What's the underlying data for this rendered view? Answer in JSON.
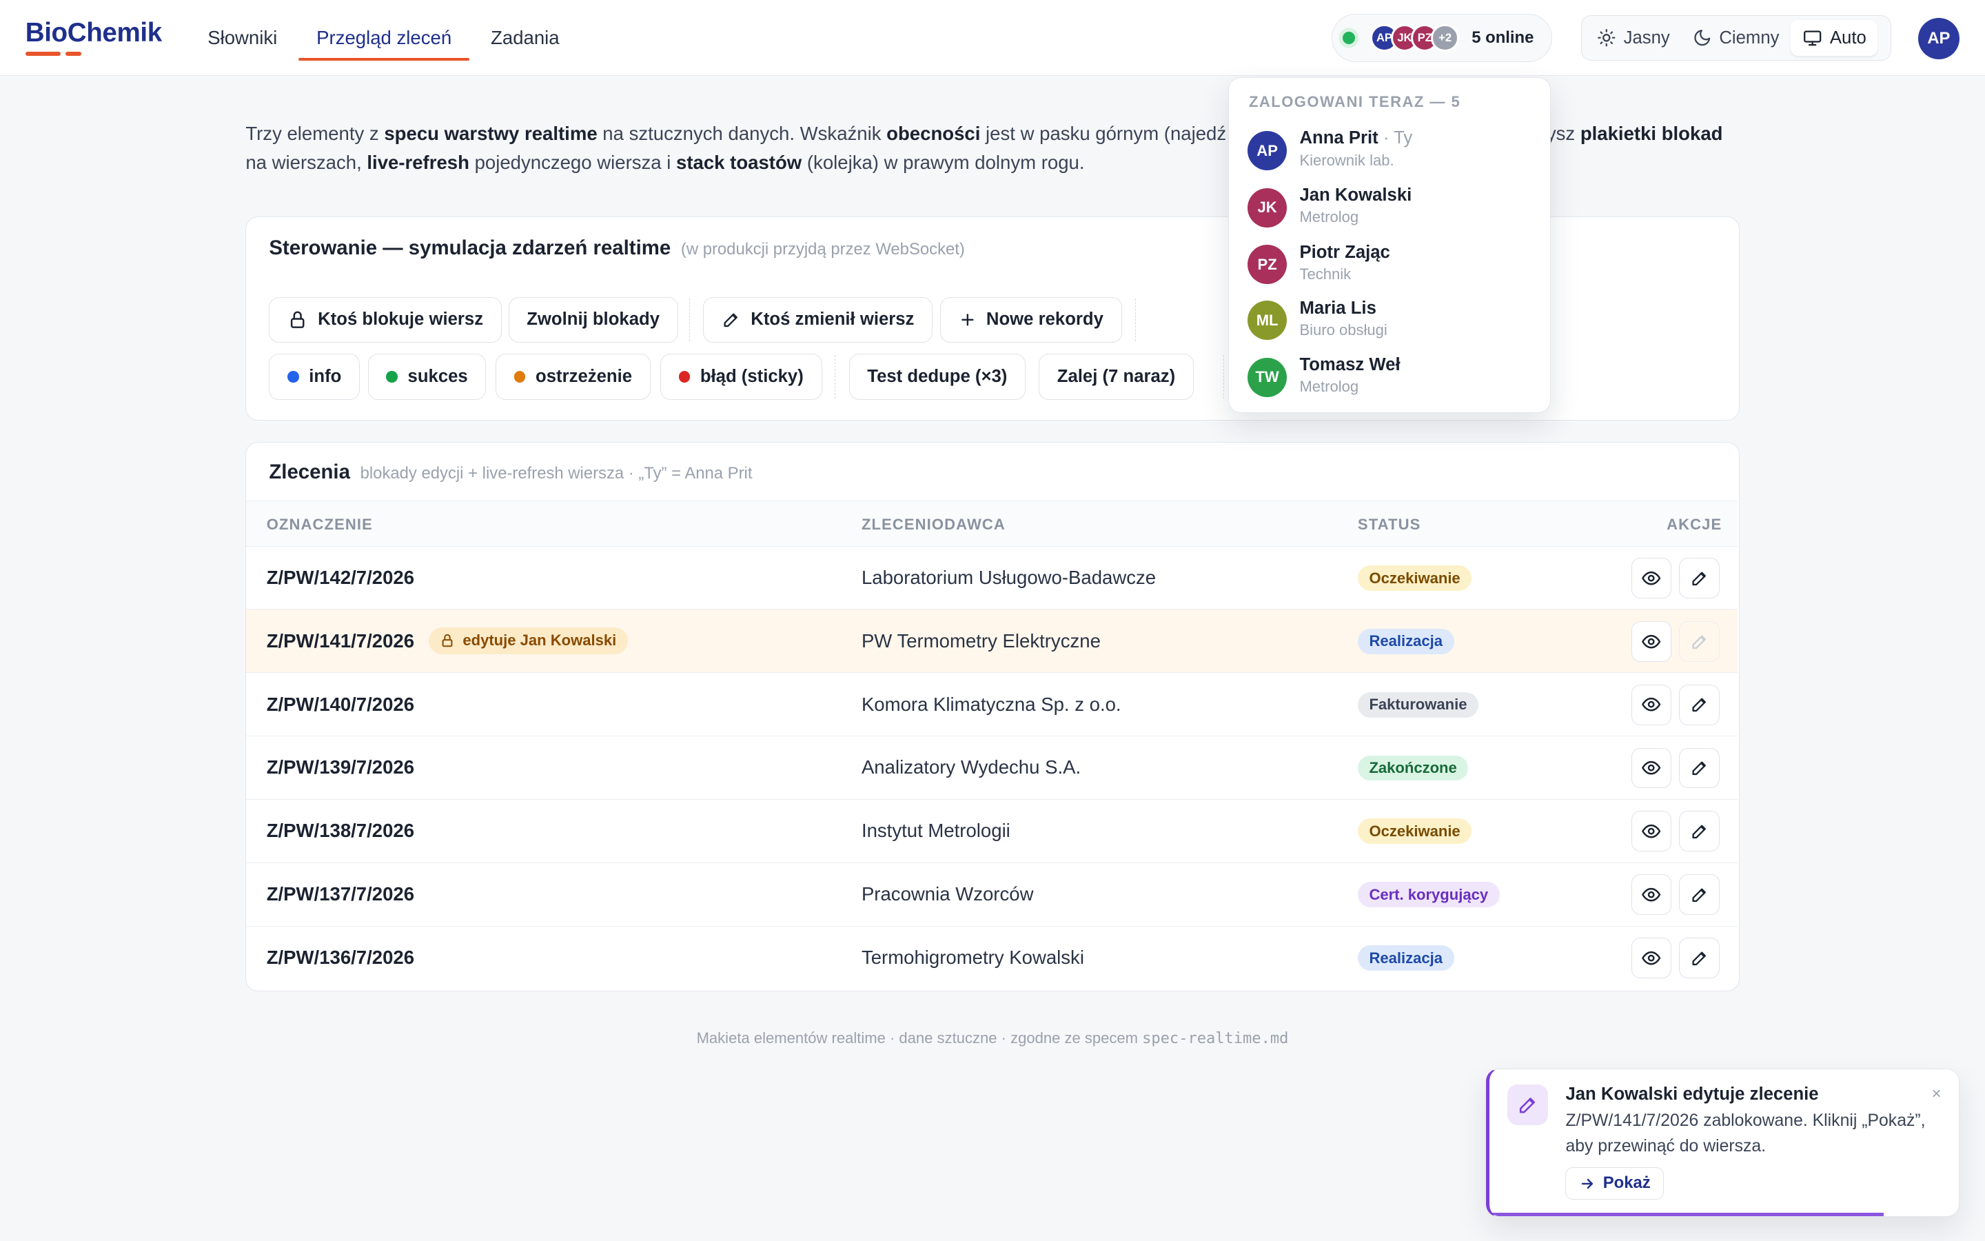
{
  "app": {
    "logo": "BioChemik"
  },
  "nav": [
    {
      "label": "Słowniki",
      "active": false
    },
    {
      "label": "Przegląd zleceń",
      "active": true
    },
    {
      "label": "Zadania",
      "active": false
    }
  ],
  "presence": {
    "count_label": "5 online",
    "stack": [
      {
        "initials": "AP",
        "color": "#2c3aa0"
      },
      {
        "initials": "JK",
        "color": "#a8305a"
      },
      {
        "initials": "PZ",
        "color": "#a8305a"
      },
      {
        "initials": "+2",
        "color": "#9aa1ad"
      }
    ]
  },
  "theme": {
    "light": "Jasny",
    "dark": "Ciemny",
    "auto": "Auto",
    "active": "auto"
  },
  "me": {
    "initials": "AP"
  },
  "intro": {
    "p1": "Trzy elementy z ",
    "b1": "specu warstwy realtime",
    "p2": " na sztucznych danych. Wskaźnik ",
    "b2": "obecności",
    "p3": " jest w pasku górnym (najedź",
    "p4": "ysz ",
    "b3": "plakietki blokad",
    "p5": "na wierszach, ",
    "b4": "live-refresh",
    "p6": " pojedynczego wiersza i ",
    "b5": "stack toastów",
    "p7": " (kolejka) w prawym dolnym rogu."
  },
  "controls": {
    "title": "Sterowanie — symulacja zdarzeń realtime",
    "subtitle": "(w produkcji przyjdą przez WebSocket)",
    "lock_row": "Ktoś blokuje wiersz",
    "release_locks": "Zwolnij blokady",
    "changed_row": "Ktoś zmienił wiersz",
    "new_records": "Nowe rekordy",
    "info": "info",
    "success": "sukces",
    "warning": "ostrzeżenie",
    "error": "błąd (sticky)",
    "dedupe": "Test dedupe (×3)",
    "flood": "Zalej (7 naraz)",
    "colors": {
      "info": "#2563eb",
      "success": "#16a34a",
      "warning": "#e07b0c",
      "error": "#dc2626"
    }
  },
  "orders": {
    "title": "Zlecenia",
    "subtitle": "blokady edycji + live-refresh wiersza · „Ty” = Anna Prit",
    "columns": {
      "id": "OZNACZENIE",
      "client": "ZLECENIODAWCA",
      "status": "STATUS",
      "actions": "AKCJE"
    },
    "rows": [
      {
        "id": "Z/PW/142/7/2026",
        "client": "Laboratorium Usługowo-Badawcze",
        "status": "Oczekiwanie",
        "sbg": "#fdf1c9",
        "sfg": "#7a4b00"
      },
      {
        "id": "Z/PW/141/7/2026",
        "client": "PW Termometry Elektryczne",
        "status": "Realizacja",
        "sbg": "#dde8fb",
        "sfg": "#1d4aa8",
        "lock": "edytuje Jan Kowalski"
      },
      {
        "id": "Z/PW/140/7/2026",
        "client": "Komora Klimatyczna Sp. z o.o.",
        "status": "Fakturowanie",
        "sbg": "#e8eaee",
        "sfg": "#3b4456"
      },
      {
        "id": "Z/PW/139/7/2026",
        "client": "Analizatory Wydechu S.A.",
        "status": "Zakończone",
        "sbg": "#daf4e3",
        "sfg": "#17693a"
      },
      {
        "id": "Z/PW/138/7/2026",
        "client": "Instytut Metrologii",
        "status": "Oczekiwanie",
        "sbg": "#fdf1c9",
        "sfg": "#7a4b00"
      },
      {
        "id": "Z/PW/137/7/2026",
        "client": "Pracownia Wzorców",
        "status": "Cert. korygujący",
        "sbg": "#efe6fb",
        "sfg": "#6a2fbf"
      },
      {
        "id": "Z/PW/136/7/2026",
        "client": "Termohigrometry Kowalski",
        "status": "Realizacja",
        "sbg": "#dde8fb",
        "sfg": "#1d4aa8"
      }
    ]
  },
  "footer": {
    "text": "Makieta elementów realtime · dane sztuczne · zgodne ze specem ",
    "code": "spec-realtime.md"
  },
  "online_dropdown": {
    "heading": "ZALOGOWANI TERAZ — 5",
    "users": [
      {
        "initials": "AP",
        "name": "Anna Prit",
        "you": " · Ty",
        "role": "Kierownik lab.",
        "color": "#2c3aa0"
      },
      {
        "initials": "JK",
        "name": "Jan Kowalski",
        "role": "Metrolog",
        "color": "#a8305a"
      },
      {
        "initials": "PZ",
        "name": "Piotr Zając",
        "role": "Technik",
        "color": "#a8305a"
      },
      {
        "initials": "ML",
        "name": "Maria Lis",
        "role": "Biuro obsługi",
        "color": "#8a9a2a"
      },
      {
        "initials": "TW",
        "name": "Tomasz Weł",
        "role": "Metrolog",
        "color": "#2ba24a"
      }
    ]
  },
  "toast": {
    "title": "Jan Kowalski edytuje zlecenie",
    "message": "Z/PW/141/7/2026 zablokowane. Kliknij „Pokaż”, aby przewinąć do wiersza.",
    "action": "Pokaż",
    "close": "×",
    "progress": 0.84
  }
}
